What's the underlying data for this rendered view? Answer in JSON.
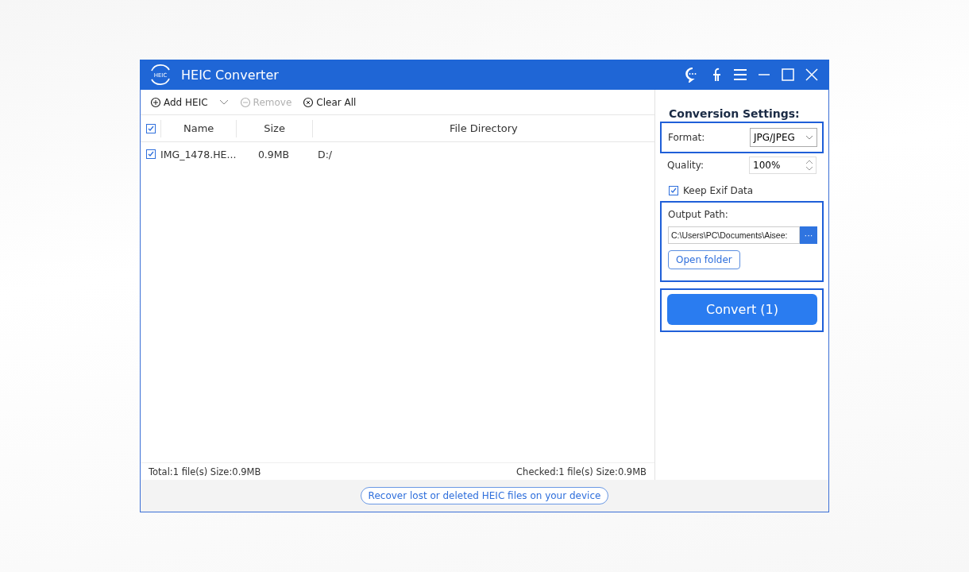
{
  "window": {
    "title": "HEIC Converter",
    "logo_text": "HEIC"
  },
  "toolbar": [
    {
      "kind": "add",
      "label": "Add HEIC",
      "disabled": false
    },
    {
      "kind": "remove",
      "label": "Remove",
      "disabled": true
    },
    {
      "kind": "clear",
      "label": "Clear All",
      "disabled": false
    }
  ],
  "table": {
    "all_checked": true,
    "columns": [
      "Name",
      "Size",
      "File Directory"
    ],
    "rows": [
      {
        "checked": true,
        "cells": [
          "IMG_1478.HE...",
          "0.9MB",
          "D:/"
        ]
      }
    ]
  },
  "status": {
    "total": "Total:1 file(s) Size:0.9MB",
    "checked": "Checked:1 file(s) Size:0.9MB"
  },
  "settings": {
    "title": "Conversion Settings:",
    "format": {
      "label": "Format:",
      "value": "JPG/JPEG",
      "highlighted": true
    },
    "quality": {
      "label": "Quality:",
      "value": "100%"
    },
    "keep_exif": {
      "label": "Keep Exif Data",
      "checked": true
    },
    "output": {
      "label": "Output Path:",
      "value": "C:\\Users\\PC\\Documents\\Aisee:",
      "browse": "···",
      "open_folder": "Open folder",
      "highlighted": true
    },
    "convert": {
      "label": "Convert (1)",
      "highlighted": true
    }
  },
  "recover_link": "Recover lost or deleted HEIC files on your device"
}
